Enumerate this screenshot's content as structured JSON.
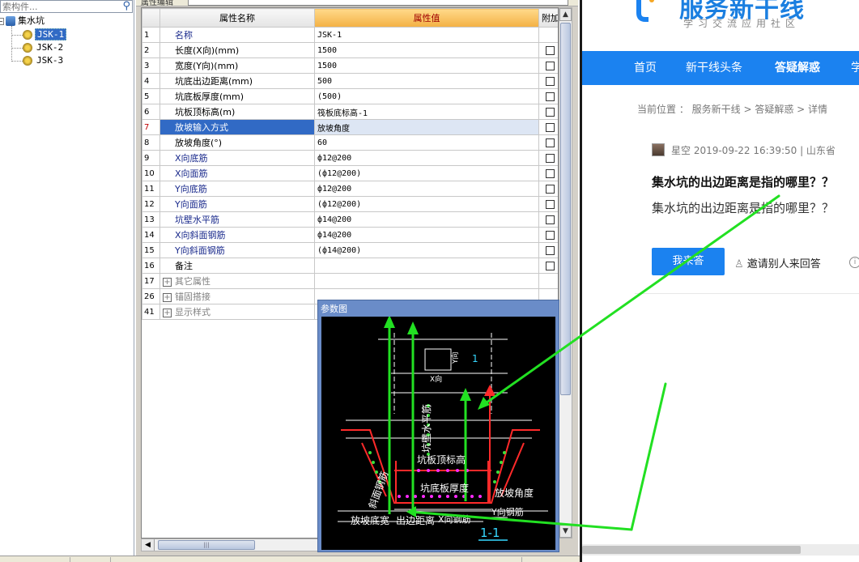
{
  "search": {
    "placeholder": "索构件..."
  },
  "tree": {
    "root_label": "集水坑",
    "items": [
      "JSK-1",
      "JSK-2",
      "JSK-3"
    ]
  },
  "grid": {
    "top_caption": "属性编辑",
    "col_name": "属性名称",
    "col_value": "属性值",
    "col_extra": "附加",
    "rows": [
      {
        "num": "1",
        "name": "名称",
        "value": "JSK-1",
        "checkbox": false
      },
      {
        "num": "2",
        "name": "长度(X向)(mm)",
        "value": "1500",
        "checkbox": true
      },
      {
        "num": "3",
        "name": "宽度(Y向)(mm)",
        "value": "1500",
        "checkbox": true
      },
      {
        "num": "4",
        "name": "坑底出边距离(mm)",
        "value": "500",
        "checkbox": true
      },
      {
        "num": "5",
        "name": "坑底板厚度(mm)",
        "value": "(500)",
        "checkbox": true
      },
      {
        "num": "6",
        "name": "坑板顶标高(m)",
        "value": "筏板底标高-1",
        "checkbox": true
      },
      {
        "num": "7",
        "name": "放坡输入方式",
        "value": "放坡角度",
        "checkbox": true
      },
      {
        "num": "8",
        "name": "放坡角度(°)",
        "value": "60",
        "checkbox": true
      },
      {
        "num": "9",
        "name": "X向底筋",
        "value": "ф12@200",
        "checkbox": true
      },
      {
        "num": "10",
        "name": "X向面筋",
        "value": "(ф12@200)",
        "checkbox": true
      },
      {
        "num": "11",
        "name": "Y向底筋",
        "value": "ф12@200",
        "checkbox": true
      },
      {
        "num": "12",
        "name": "Y向面筋",
        "value": "(ф12@200)",
        "checkbox": true
      },
      {
        "num": "13",
        "name": "坑壁水平筋",
        "value": "ф14@200",
        "checkbox": true
      },
      {
        "num": "14",
        "name": "X向斜面钢筋",
        "value": "ф14@200",
        "checkbox": true
      },
      {
        "num": "15",
        "name": "Y向斜面钢筋",
        "value": "(ф14@200)",
        "checkbox": true
      },
      {
        "num": "16",
        "name": "备注",
        "value": "",
        "checkbox": true
      },
      {
        "num": "17",
        "name": "其它属性",
        "value": "",
        "checkbox": false
      },
      {
        "num": "26",
        "name": "锚固搭接",
        "value": "",
        "checkbox": false
      },
      {
        "num": "41",
        "name": "显示样式",
        "value": "",
        "checkbox": false
      }
    ]
  },
  "diagram": {
    "title": "参数图",
    "labels": {
      "x_dir": "X向",
      "y_dir": "Y向",
      "one": "1",
      "wall_rebar": "坑壁水平筋",
      "top_elev": "坑板顶标高",
      "slope_rebar": "斜面钢筋",
      "bottom_thick": "坑底板厚度",
      "slope_angle": "放坡角度",
      "y_rebar": "Y向钢筋",
      "slope_width": "放坡底宽",
      "edge_dist": "出边距离",
      "x_rebar": "X向钢筋",
      "section": "1-1"
    }
  },
  "web": {
    "logo_text": "服务新干线",
    "logo_sub": "学习交流应用社区",
    "nav": [
      "首页",
      "新干线头条",
      "答疑解惑",
      "学"
    ],
    "breadcrumb": "当前位置 ： 服务新干线 > 答疑解惑 > 详情",
    "meta": "星空   2019-09-22 16:39:50   |   山东省",
    "question_title": "集水坑的出边距离是指的哪里？？",
    "question_body": "集水坑的出边距离是指的哪里？？",
    "answer_button": "我来答",
    "invite_label": "邀请别人来回答",
    "info_icon": "i"
  },
  "colors": {
    "accent": "#1b82f0",
    "selection": "#316ac5",
    "arrow": "#22dd22"
  }
}
